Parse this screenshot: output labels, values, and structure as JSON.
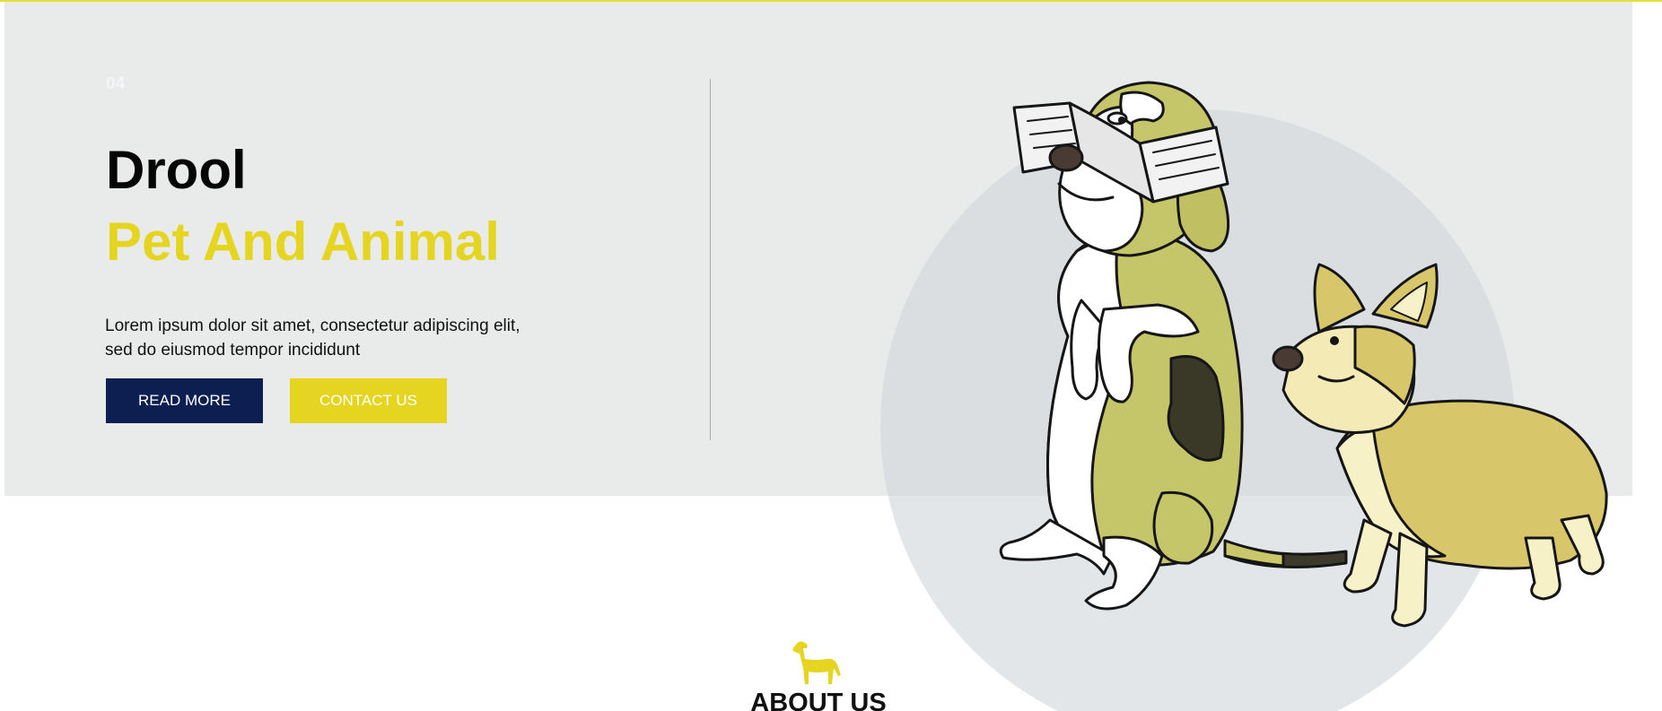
{
  "hero": {
    "slide_number": "04",
    "title": "Drool",
    "subtitle": "Pet And Animal",
    "description_line1": "Lorem ipsum dolor sit amet, consectetur adipiscing elit,",
    "description_line2": "sed do eiusmod tempor incididunt",
    "read_more_label": "READ MORE",
    "contact_label": "CONTACT US",
    "image": "beagle-holding-newspaper-and-corgi-illustration"
  },
  "about": {
    "icon": "dog-icon",
    "title": "ABOUT US"
  },
  "colors": {
    "accent_yellow": "#e6d520",
    "navy": "#0d1f50",
    "hero_background": "#e9eaea",
    "circle": "#d2d6db"
  }
}
